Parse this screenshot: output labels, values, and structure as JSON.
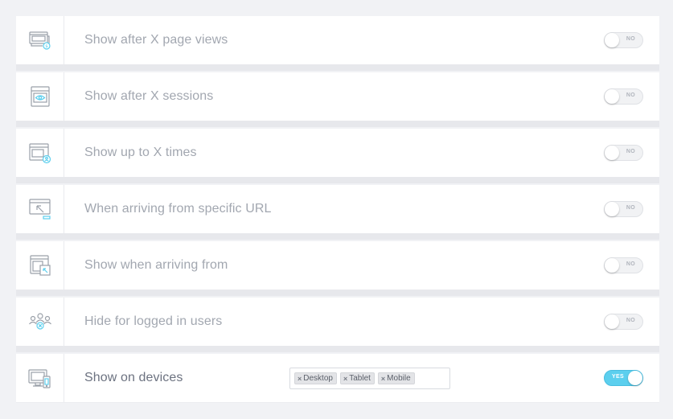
{
  "colors": {
    "icon_stroke": "#9aa0a9",
    "icon_accent": "#5ccfee",
    "toggle_on": "#5ccfee"
  },
  "rules": [
    {
      "label": "Show after X page views",
      "icon": "browser-coin-icon",
      "toggle": "NO"
    },
    {
      "label": "Show after X sessions",
      "icon": "browser-eye-icon",
      "toggle": "NO"
    },
    {
      "label": "Show up to X times",
      "icon": "browser-user-icon",
      "toggle": "NO"
    },
    {
      "label": "When arriving from specific URL",
      "icon": "url-arrow-icon",
      "toggle": "NO"
    },
    {
      "label": "Show when arriving from",
      "icon": "browser-arrow-icon",
      "toggle": "NO"
    },
    {
      "label": "Hide for logged in users",
      "icon": "users-icon",
      "toggle": "NO"
    },
    {
      "label": "Show on devices",
      "icon": "devices-icon",
      "toggle": "YES"
    }
  ],
  "devices": {
    "tags": [
      {
        "remove": "×",
        "label": "Desktop"
      },
      {
        "remove": "×",
        "label": "Tablet"
      },
      {
        "remove": "×",
        "label": "Mobile"
      }
    ]
  }
}
